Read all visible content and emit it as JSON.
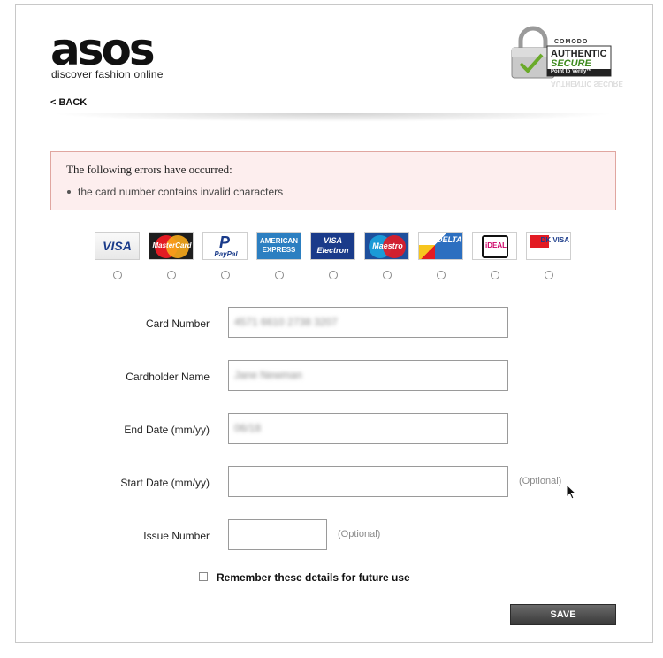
{
  "header": {
    "logo_text": "asos",
    "tagline": "discover fashion online",
    "back_label": "< BACK",
    "badge": {
      "brand": "COMODO",
      "line1": "AUTHENTIC",
      "line2": "SECURE",
      "line3": "Point to Verify™",
      "reflection": "AUTHENTIC SECURE"
    }
  },
  "errors": {
    "title": "The following errors have occurred:",
    "items": [
      "the card number contains invalid characters"
    ]
  },
  "card_types": [
    {
      "name": "visa",
      "label": "VISA"
    },
    {
      "name": "mastercard",
      "label": "MasterCard"
    },
    {
      "name": "paypal",
      "label": "PayPal"
    },
    {
      "name": "american-express",
      "label": "AMERICAN EXPRESS"
    },
    {
      "name": "visa-electron",
      "label": "VISA Electron"
    },
    {
      "name": "maestro",
      "label": "Maestro"
    },
    {
      "name": "delta",
      "label": "DELTA"
    },
    {
      "name": "ideal",
      "label": "iDEAL"
    },
    {
      "name": "dankort",
      "label": "DK VISA"
    }
  ],
  "form": {
    "card_number": {
      "label": "Card Number",
      "value": "4571 6610 2738 3207"
    },
    "cardholder_name": {
      "label": "Cardholder Name",
      "value": "Jane Newman"
    },
    "end_date": {
      "label": "End Date (mm/yy)",
      "value": "06/18"
    },
    "start_date": {
      "label": "Start Date (mm/yy)",
      "value": "",
      "optional": "(Optional)"
    },
    "issue_number": {
      "label": "Issue Number",
      "value": "",
      "optional": "(Optional)"
    },
    "remember_label": "Remember these details for future use",
    "save_label": "SAVE"
  },
  "colors": {
    "error_bg": "#fdeeee",
    "error_border": "#e0a6a0",
    "save_button": "#4a4a4a"
  }
}
